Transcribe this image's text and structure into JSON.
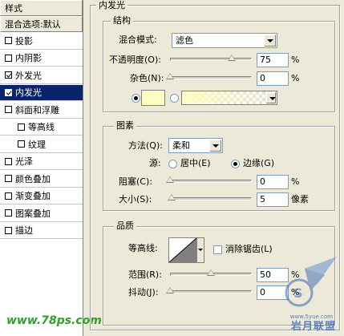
{
  "style_list": {
    "title": "样式",
    "items": [
      {
        "label": "混合选项:默认",
        "type": "header"
      },
      {
        "label": "投影",
        "checked": false,
        "indent": false
      },
      {
        "label": "内阴影",
        "checked": false,
        "indent": false
      },
      {
        "label": "外发光",
        "checked": true,
        "indent": false
      },
      {
        "label": "内发光",
        "checked": true,
        "indent": false,
        "selected": true
      },
      {
        "label": "斜面和浮雕",
        "checked": false,
        "indent": false
      },
      {
        "label": "等高线",
        "checked": false,
        "indent": true
      },
      {
        "label": "纹理",
        "checked": false,
        "indent": true
      },
      {
        "label": "光泽",
        "checked": false,
        "indent": false
      },
      {
        "label": "颜色叠加",
        "checked": false,
        "indent": false
      },
      {
        "label": "渐变叠加",
        "checked": false,
        "indent": false
      },
      {
        "label": "图案叠加",
        "checked": false,
        "indent": false
      },
      {
        "label": "描边",
        "checked": false,
        "indent": false
      }
    ],
    "watermark": "www.78ps.com"
  },
  "panel": {
    "title": "内发光",
    "structure": {
      "title": "结构",
      "blend_mode_label": "混合模式:",
      "blend_mode_value": "滤色",
      "opacity_label": "不透明度(O):",
      "opacity_value": "75",
      "opacity_level": 0.75,
      "noise_label": "杂色(N):",
      "noise_value": "0",
      "noise_level": 0,
      "unit": "%",
      "swatch_color": "#fffcc0"
    },
    "elements": {
      "title": "图素",
      "technique_label": "方法(Q):",
      "technique_value": "柔和",
      "source_label": "源:",
      "source_center": "居中(E)",
      "source_edge": "边缘(G)",
      "choke_label": "阻塞(C):",
      "choke_value": "0",
      "choke_level": 0,
      "size_label": "大小(S):",
      "size_value": "5",
      "size_level": 0.02,
      "unit_percent": "%",
      "unit_pixel": "像素"
    },
    "quality": {
      "title": "品质",
      "contour_label": "等高线:",
      "antialias_label": "消除锯齿(L)",
      "range_label": "范围(R):",
      "range_value": "50",
      "range_level": 0.5,
      "jitter_label": "抖动(J):",
      "jitter_value": "0",
      "jitter_level": 0,
      "unit": "%"
    }
  },
  "watermark": {
    "brand": "岩月联盟",
    "url": "www.5yue.com"
  }
}
